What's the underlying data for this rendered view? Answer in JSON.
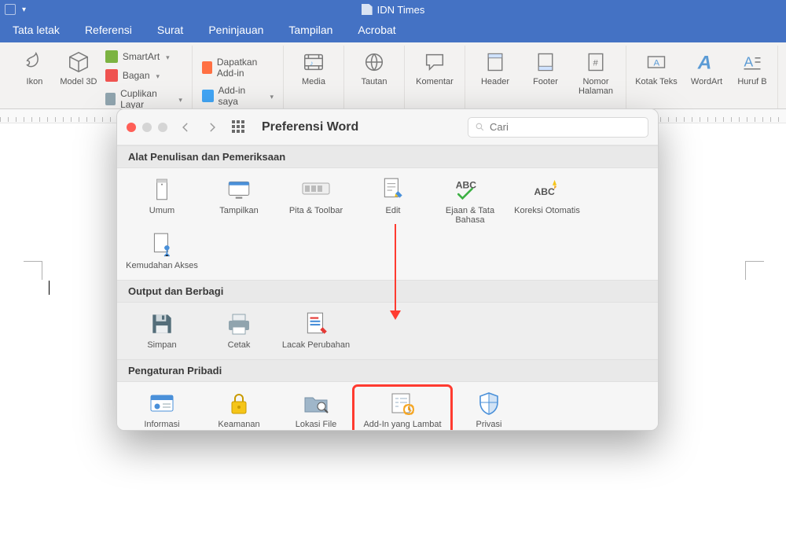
{
  "window": {
    "title": "IDN Times"
  },
  "ribbon": {
    "tabs": [
      "Tata letak",
      "Referensi",
      "Surat",
      "Peninjauan",
      "Tampilan",
      "Acrobat"
    ],
    "ikon": "Ikon",
    "model3d": "Model 3D",
    "smartart": "SmartArt",
    "bagan": "Bagan",
    "cuplikan": "Cuplikan Layar",
    "get_addin": "Dapatkan Add-in",
    "my_addin": "Add-in saya",
    "media": "Media",
    "tautan": "Tautan",
    "komentar": "Komentar",
    "header": "Header",
    "footer": "Footer",
    "nomor": "Nomor Halaman",
    "kotak": "Kotak Teks",
    "wordart": "WordArt",
    "huruf": "Huruf B"
  },
  "dialog": {
    "title": "Preferensi Word",
    "search_placeholder": "Cari",
    "sections": {
      "s1": {
        "title": "Alat Penulisan dan Pemeriksaan",
        "items": {
          "umum": "Umum",
          "tampilkan": "Tampilkan",
          "pita": "Pita & Toolbar",
          "edit": "Edit",
          "ejaan": "Ejaan & Tata Bahasa",
          "koreksi": "Koreksi Otomatis",
          "akses": "Kemudahan Akses"
        }
      },
      "s2": {
        "title": "Output dan Berbagi",
        "items": {
          "simpan": "Simpan",
          "cetak": "Cetak",
          "lacak": "Lacak Perubahan"
        }
      },
      "s3": {
        "title": "Pengaturan Pribadi",
        "items": {
          "info": "Informasi Pengguna",
          "keamanan": "Keamanan",
          "lokasi": "Lokasi File",
          "addin": "Add-In yang Lambat dan Nonaktif",
          "privasi": "Privasi"
        }
      }
    }
  },
  "colors": {
    "accent": "#4472c4",
    "highlight": "#ff3b30"
  }
}
